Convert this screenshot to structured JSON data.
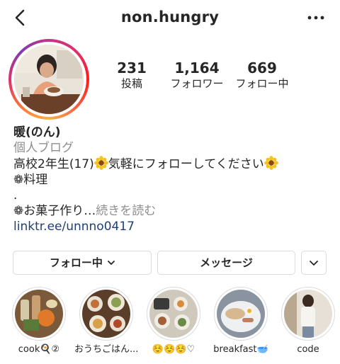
{
  "header": {
    "username": "non.hungry",
    "back_icon": "chevron-left-icon",
    "more_icon": "ellipsis-icon"
  },
  "profile": {
    "avatar_icon": "profile-photo",
    "stats": {
      "posts": {
        "value": "231",
        "label": "投稿"
      },
      "followers": {
        "value": "1,164",
        "label": "フォロワー"
      },
      "following": {
        "value": "669",
        "label": "フォロー中"
      }
    }
  },
  "bio": {
    "name": "暖(のん)",
    "category": "個人ブログ",
    "line1_text": "高校2年生(17)",
    "line1_mid": "気軽にフォローしてください",
    "line2": "❁料理",
    "line3": ".",
    "line4": "❁お菓子作り…",
    "more": "続きを読む",
    "link": "linktr.ee/unnno0417"
  },
  "actions": {
    "following_label": "フォロー中",
    "message_label": "メッセージ"
  },
  "highlights": [
    {
      "label": "cook🍳②"
    },
    {
      "label": "おうちごはん..."
    },
    {
      "label": "☺️☺️☺️♡"
    },
    {
      "label": "breakfast🥣"
    },
    {
      "label": "code"
    }
  ],
  "colors": {
    "link": "#1f3f75",
    "secondary_text": "#8e8e8e",
    "border": "#dbdbdb"
  }
}
